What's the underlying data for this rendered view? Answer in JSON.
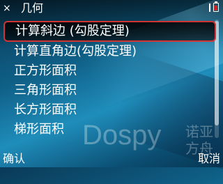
{
  "window": {
    "title": "几何",
    "close_glyph": "×",
    "status_icons": [
      "signal-bar-icon",
      "battery-icon"
    ]
  },
  "menu": {
    "items": [
      {
        "label": "计算斜边 (勾股定理)",
        "selected": true
      },
      {
        "label": "计算直角边(勾股定理)",
        "selected": false
      },
      {
        "label": "正方形面积",
        "selected": false
      },
      {
        "label": "三角形面积",
        "selected": false
      },
      {
        "label": "长方形面积",
        "selected": false
      },
      {
        "label": "梯形面积",
        "selected": false
      }
    ]
  },
  "watermark": {
    "latin": "Dospy",
    "cn_line1": "诺亚",
    "cn_line2": "方舟"
  },
  "softkeys": {
    "left": "确认",
    "right": "取消"
  },
  "colors": {
    "selection_border": "#d23434",
    "background_primary": "#0f5f86"
  }
}
